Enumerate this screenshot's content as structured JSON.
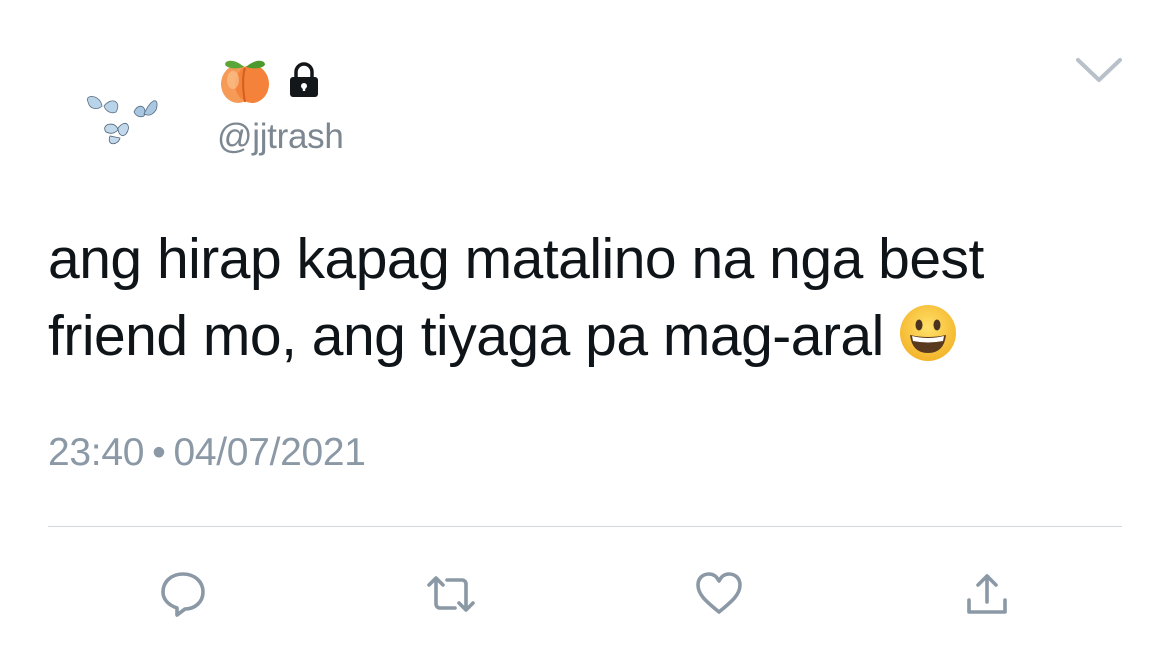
{
  "tweet": {
    "handle": "@jjtrash",
    "name_emoji": "peach",
    "protected_icon": "lock-icon",
    "avatar": "butterflies",
    "text_line1": "ang hirap kapag matalino na nga best",
    "text_line2": "friend mo, ang tiyaga pa mag-aral",
    "text_emoji": "grinning-face",
    "time": "23:40",
    "separator": "•",
    "date": "04/07/2021"
  },
  "actions": [
    {
      "name": "reply",
      "icon": "speech-bubble-icon"
    },
    {
      "name": "retweet",
      "icon": "retweet-icon"
    },
    {
      "name": "like",
      "icon": "heart-icon"
    },
    {
      "name": "share",
      "icon": "share-icon"
    }
  ],
  "colors": {
    "text": "#0f1419",
    "secondary": "#7c8791",
    "action_icon": "#8b98a5",
    "divider": "#cfd9de",
    "peach": "#f7883a",
    "emoji_yellow": "#f9c642"
  }
}
